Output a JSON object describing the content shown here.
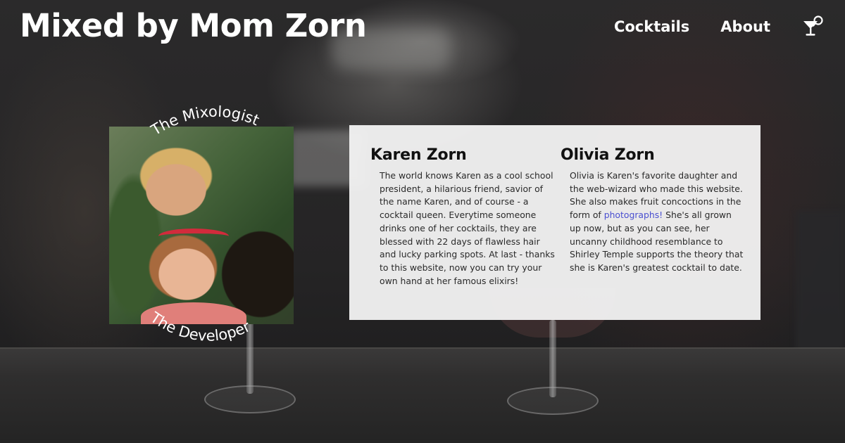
{
  "header": {
    "site_title": "Mixed by Mom Zorn",
    "nav": {
      "cocktails_label": "Cocktails",
      "about_label": "About"
    },
    "icon": "cocktail-glass-search-icon"
  },
  "photo": {
    "top_caption": "The Mixologist",
    "bottom_caption": "The Developer",
    "alt": "photo-of-karen-and-olivia"
  },
  "bios": {
    "karen": {
      "name": "Karen Zorn",
      "text": "The world knows Karen as a cool school president, a hilarious friend, savior of the name Karen, and of course - a cocktail queen. Everytime someone drinks one of her cocktails, they are blessed with 22 days of flawless hair and lucky parking spots. At last - thanks to this website, now you can try your own hand at her famous elixirs!"
    },
    "olivia": {
      "name": "Olivia Zorn",
      "text_before": "Olivia is Karen's favorite daughter and the web-wizard who made this website. She also makes fruit concoctions in the form of ",
      "link_label": "photographs!",
      "text_after": " She's all grown up now, but as you can see, her uncanny childhood resemblance to Shirley Temple supports the theory that she is Karen's greatest cocktail to date."
    }
  },
  "colors": {
    "link": "#4a4fd0",
    "card_bg": "#f1f1f1",
    "header_text": "#ffffff"
  }
}
